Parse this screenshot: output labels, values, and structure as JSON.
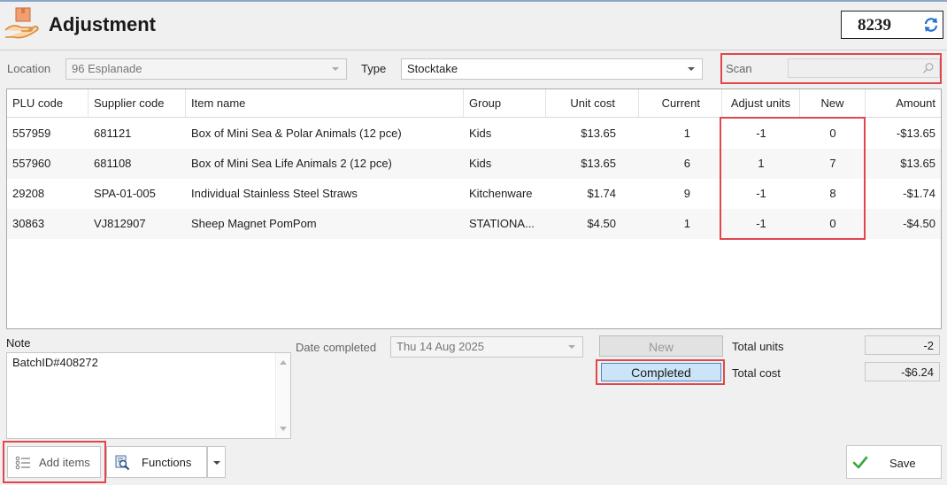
{
  "header": {
    "title": "Adjustment",
    "doc_number": "8239"
  },
  "filters": {
    "location_label": "Location",
    "location_value": "96 Esplanade",
    "type_label": "Type",
    "type_value": "Stocktake",
    "scan_label": "Scan",
    "scan_value": ""
  },
  "grid": {
    "columns": [
      "PLU code",
      "Supplier code",
      "Item name",
      "Group",
      "Unit cost",
      "Current",
      "Adjust units",
      "New",
      "Amount"
    ],
    "rows": [
      {
        "plu": "557959",
        "supplier": "681121",
        "name": "Box of Mini Sea & Polar Animals (12 pce)",
        "group": "Kids",
        "unit_cost": "$13.65",
        "current": "1",
        "adjust": "-1",
        "new": "0",
        "amount": "-$13.65"
      },
      {
        "plu": "557960",
        "supplier": "681108",
        "name": "Box of Mini Sea Life Animals 2 (12 pce)",
        "group": "Kids",
        "unit_cost": "$13.65",
        "current": "6",
        "adjust": "1",
        "new": "7",
        "amount": "$13.65"
      },
      {
        "plu": "29208",
        "supplier": "SPA-01-005",
        "name": "Individual Stainless Steel Straws",
        "group": "Kitchenware",
        "unit_cost": "$1.74",
        "current": "9",
        "adjust": "-1",
        "new": "8",
        "amount": "-$1.74"
      },
      {
        "plu": "30863",
        "supplier": "VJ812907",
        "name": "Sheep Magnet PomPom",
        "group": "STATIONA...",
        "unit_cost": "$4.50",
        "current": "1",
        "adjust": "-1",
        "new": "0",
        "amount": "-$4.50"
      }
    ]
  },
  "note": {
    "label": "Note",
    "text": "BatchID#408272"
  },
  "date_completed": {
    "label": "Date completed",
    "value": "Thu 14 Aug 2025"
  },
  "status": {
    "new_label": "New",
    "completed_label": "Completed"
  },
  "totals": {
    "units_label": "Total units",
    "units_value": "-2",
    "cost_label": "Total cost",
    "cost_value": "-$6.24"
  },
  "toolbar": {
    "add_items_label": "Add items",
    "functions_label": "Functions",
    "save_label": "Save"
  },
  "colors": {
    "highlight": "#e0474c",
    "accent_blue": "#1f6fd0",
    "completed_fill": "#cce4f7",
    "save_check": "#3aa53a"
  }
}
